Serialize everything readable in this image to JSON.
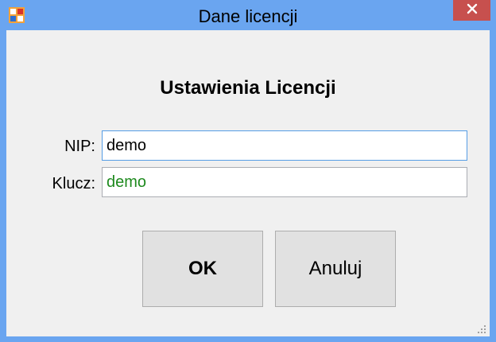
{
  "window": {
    "title": "Dane licencji",
    "icon": "app-icon",
    "close_icon": "close-icon",
    "accent_color": "#6aa5f0",
    "close_color": "#c7504e"
  },
  "dialog": {
    "heading": "Ustawienia Licencji",
    "nip_label": "NIP:",
    "nip_value": "demo",
    "klucz_label": "Klucz:",
    "klucz_value": "demo",
    "klucz_text_color": "#1e8a1e"
  },
  "buttons": {
    "ok_label": "OK",
    "cancel_label": "Anuluj"
  }
}
